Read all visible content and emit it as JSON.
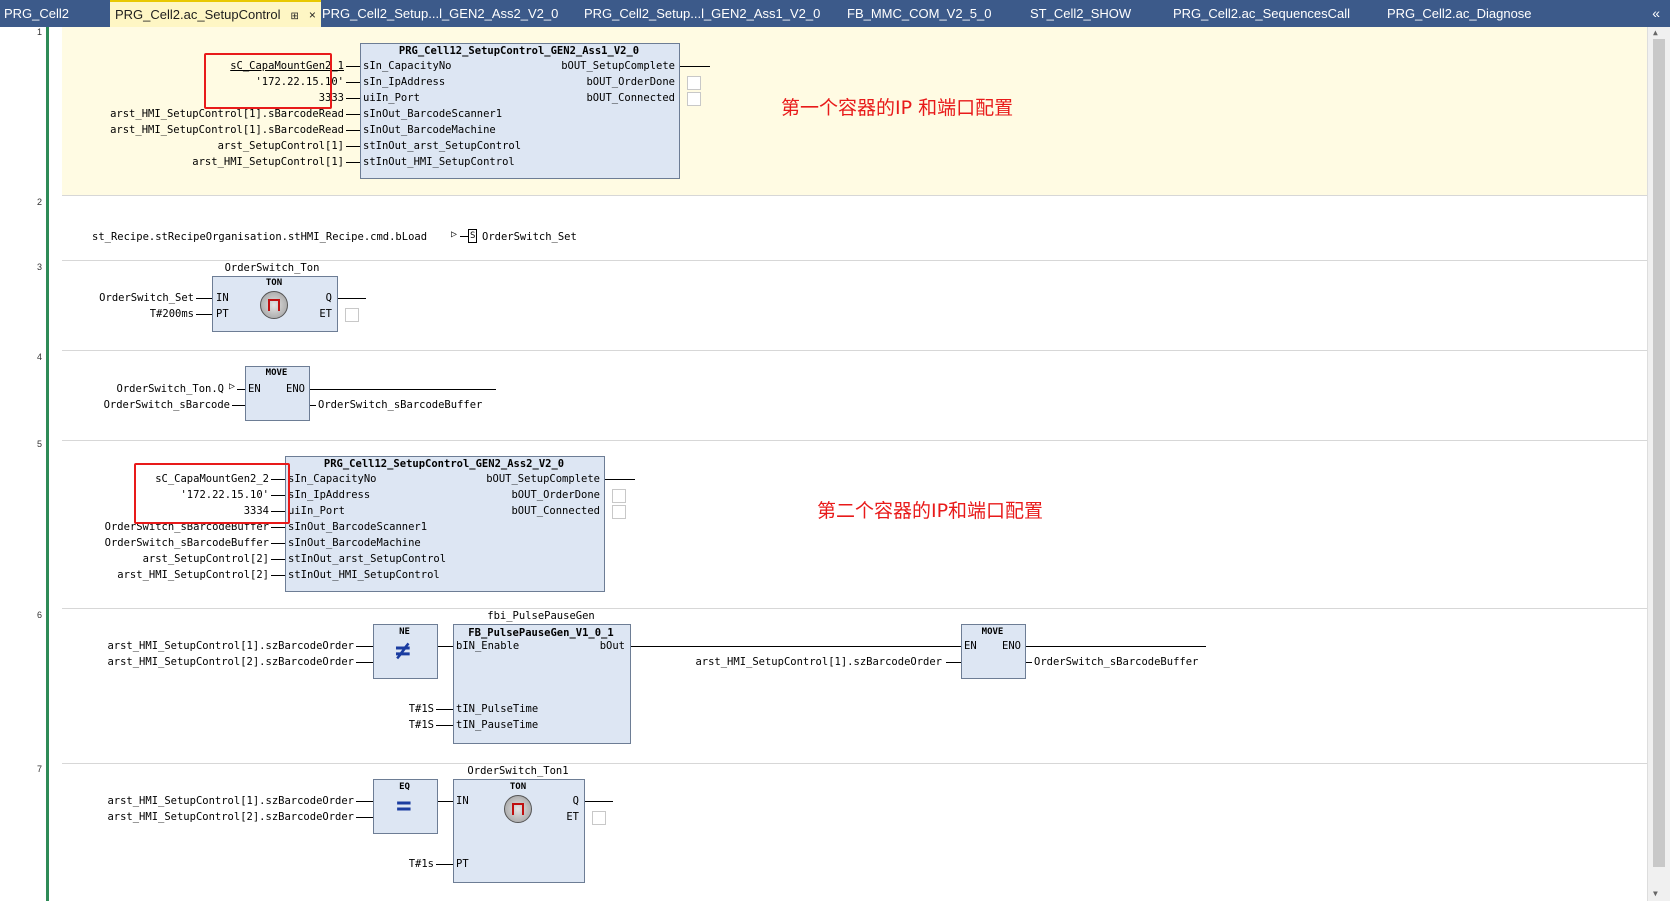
{
  "tabs": [
    {
      "label": "PRG_Cell2",
      "active": false
    },
    {
      "label": "PRG_Cell2.ac_SetupControl",
      "active": true
    },
    {
      "label": "PRG_Cell2_Setup...l_GEN2_Ass2_V2_0",
      "active": false
    },
    {
      "label": "PRG_Cell2_Setup...l_GEN2_Ass1_V2_0",
      "active": false
    },
    {
      "label": "FB_MMC_COM_V2_5_0",
      "active": false
    },
    {
      "label": "ST_Cell2_SHOW",
      "active": false
    },
    {
      "label": "PRG_Cell2.ac_SequencesCall",
      "active": false
    },
    {
      "label": "PRG_Cell2.ac_Diagnose",
      "active": false
    }
  ],
  "tab_close": "×",
  "tab_pin": "⊞",
  "tab_overflow": "«",
  "network_numbers": [
    "1",
    "2",
    "3",
    "4",
    "5",
    "6",
    "7"
  ],
  "net1": {
    "fb_name": "PRG_Cell12_SetupControl_GEN2_Ass1_V2_0",
    "in_labels": [
      "sIn_CapacityNo",
      "sIn_IpAddress",
      "uiIn_Port",
      "sInOut_BarcodeScanner1",
      "sInOut_BarcodeMachine",
      "stInOut_arst_SetupControl",
      "stInOut_HMI_SetupControl"
    ],
    "in_values": [
      "sC_CapaMountGen2_1",
      "'172.22.15.10'",
      "3333",
      "arst_HMI_SetupControl[1].sBarcodeRead",
      "arst_HMI_SetupControl[1].sBarcodeRead",
      "arst_SetupControl[1]",
      "arst_HMI_SetupControl[1]"
    ],
    "out_labels": [
      "bOUT_SetupComplete",
      "bOUT_OrderDone",
      "bOUT_Connected"
    ],
    "annotation": "第一个容器的IP 和端口配置"
  },
  "net2": {
    "contact": "st_Recipe.stRecipeOrganisation.stHMI_Recipe.cmd.bLoad",
    "coil_symbol": "S",
    "coil_var": "OrderSwitch_Set"
  },
  "net3": {
    "instance": "OrderSwitch_Ton",
    "type": "TON",
    "in_labels": [
      "IN",
      "PT"
    ],
    "out_labels": [
      "Q",
      "ET"
    ],
    "in_values": [
      "OrderSwitch_Set",
      "T#200ms"
    ]
  },
  "net4": {
    "type": "MOVE",
    "en": "EN",
    "eno": "ENO",
    "in_values": [
      "OrderSwitch_Ton.Q",
      "OrderSwitch_sBarcode"
    ],
    "output": "OrderSwitch_sBarcodeBuffer"
  },
  "net5": {
    "fb_name": "PRG_Cell12_SetupControl_GEN2_Ass2_V2_0",
    "in_labels": [
      "sIn_CapacityNo",
      "sIn_IpAddress",
      "uiIn_Port",
      "sInOut_BarcodeScanner1",
      "sInOut_BarcodeMachine",
      "stInOut_arst_SetupControl",
      "stInOut_HMI_SetupControl"
    ],
    "in_values": [
      "sC_CapaMountGen2_2",
      "'172.22.15.10'",
      "3334",
      "OrderSwitch_sBarcodeBuffer",
      "OrderSwitch_sBarcodeBuffer",
      "arst_SetupControl[2]",
      "arst_HMI_SetupControl[2]"
    ],
    "out_labels": [
      "bOUT_SetupComplete",
      "bOUT_OrderDone",
      "bOUT_Connected"
    ],
    "annotation": "第二个容器的IP和端口配置"
  },
  "net6": {
    "ne_type": "NE",
    "ne_symbol": "≠",
    "ne_inputs": [
      "arst_HMI_SetupControl[1].szBarcodeOrder",
      "arst_HMI_SetupControl[2].szBarcodeOrder"
    ],
    "instance": "fbi_PulsePauseGen",
    "fb_name": "FB_PulsePauseGen_V1_0_1",
    "fb_in_labels": [
      "bIN_Enable",
      "tIN_PulseTime",
      "tIN_PauseTime"
    ],
    "fb_out": "bOut",
    "time_values": [
      "T#1S",
      "T#1S"
    ],
    "move_type": "MOVE",
    "en": "EN",
    "eno": "ENO",
    "move_input": "arst_HMI_SetupControl[1].szBarcodeOrder",
    "move_output": "OrderSwitch_sBarcodeBuffer"
  },
  "net7": {
    "eq_type": "EQ",
    "eq_symbol": "=",
    "eq_inputs": [
      "arst_HMI_SetupControl[1].szBarcodeOrder",
      "arst_HMI_SetupControl[2].szBarcodeOrder"
    ],
    "instance": "OrderSwitch_Ton1",
    "type": "TON",
    "in_labels": [
      "IN",
      "PT"
    ],
    "out_labels": [
      "Q",
      "ET"
    ],
    "pt_value": "T#1s"
  }
}
